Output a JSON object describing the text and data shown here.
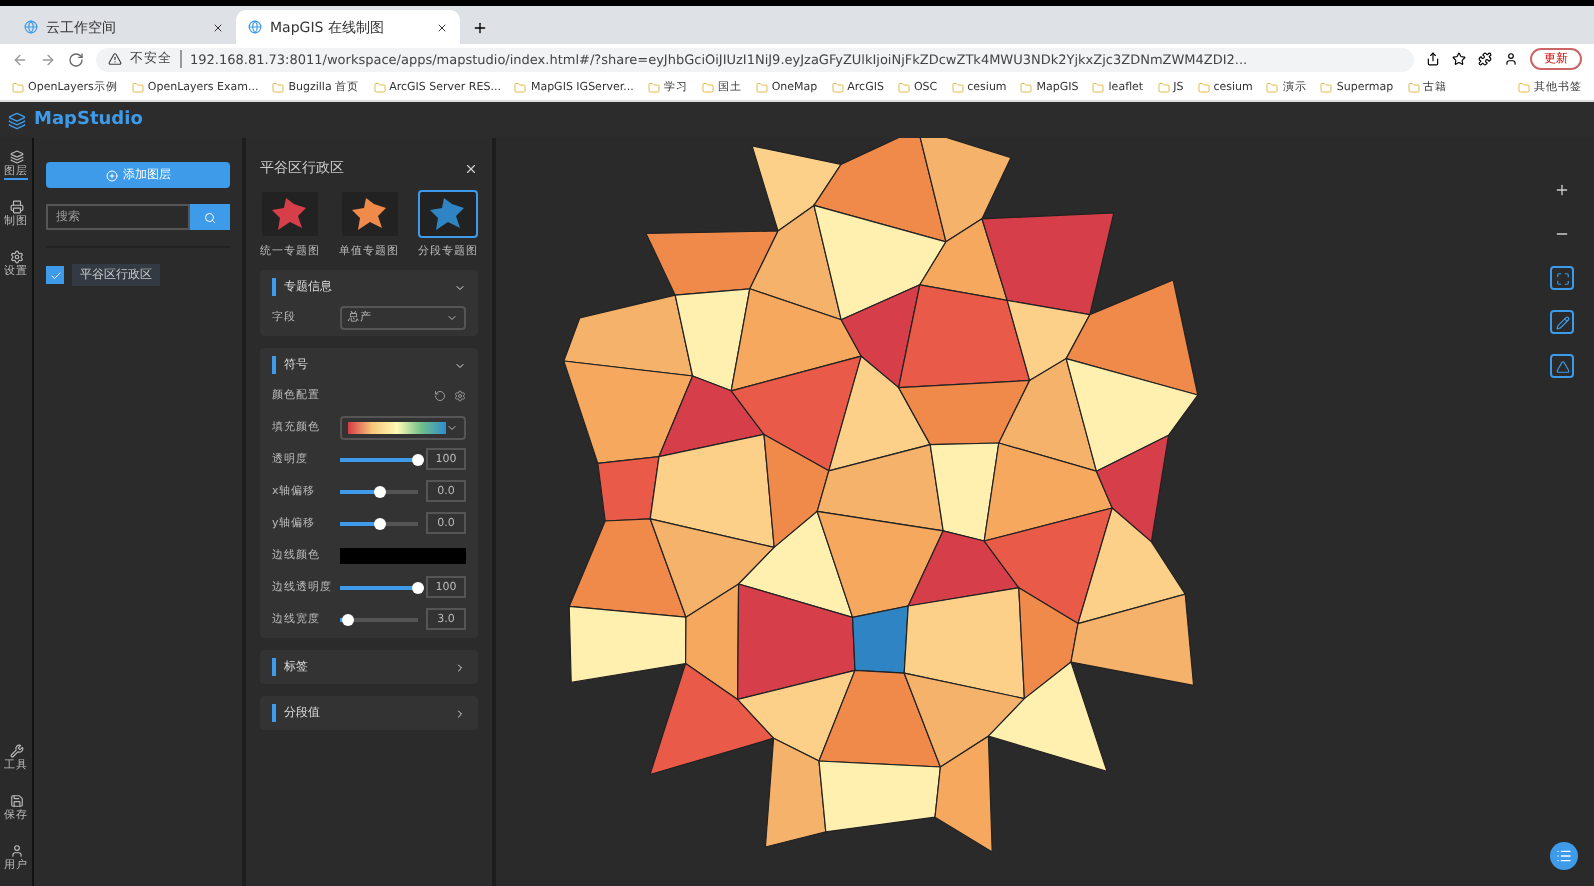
{
  "browser": {
    "tabs": [
      {
        "title": "云工作空间",
        "selected": false
      },
      {
        "title": "MapGIS 在线制图",
        "selected": true
      }
    ],
    "address": {
      "security": "不安全",
      "url": "192.168.81.73:8011/workspace/apps/mapstudio/index.html#/?share=eyJhbGciOiJIUzI1NiJ9.eyJzaGFyZUlkIjoiNjFkZDcwZTk4MWU3NDk2YjkxZjc3ZDNmZWM4ZDI2..."
    },
    "update_button": "更新",
    "bookmarks": [
      "OpenLayers示例",
      "OpenLayers Exam...",
      "Bugzilla 首页",
      "ArcGIS Server RES...",
      "MapGIS IGServer...",
      "学习",
      "国土",
      "OneMap",
      "ArcGIS",
      "OSC",
      "cesium",
      "MapGIS",
      "leaflet",
      "JS",
      "cesium",
      "演示",
      "Supermap",
      "古籍"
    ],
    "other_bookmarks": "其他书签"
  },
  "app": {
    "title": "MapStudio",
    "rail_top": [
      {
        "label": "图层",
        "selected": true
      },
      {
        "label": "制图",
        "selected": false
      },
      {
        "label": "设置",
        "selected": false
      }
    ],
    "rail_bottom": [
      {
        "label": "工具",
        "selected": false
      },
      {
        "label": "保存",
        "selected": false
      },
      {
        "label": "用户",
        "selected": false
      }
    ],
    "layer_panel": {
      "add_button": "添加图层",
      "search": {
        "placeholder": "搜索"
      },
      "layers": [
        {
          "name": "平谷区行政区",
          "checked": true
        }
      ]
    },
    "properties": {
      "title": "平谷区行政区",
      "thumbnails": [
        {
          "label": "统一专题图",
          "selected": false
        },
        {
          "label": "单值专题图",
          "selected": false
        },
        {
          "label": "分段专题图",
          "selected": true
        }
      ],
      "sections": [
        {
          "title": "专题信息",
          "expanded": true,
          "rows": [
            {
              "kind": "select",
              "label": "字段",
              "value": "总产"
            }
          ]
        },
        {
          "title": "符号",
          "expanded": true,
          "rows": [
            {
              "kind": "preset",
              "label": "颜色配置"
            },
            {
              "kind": "gradient",
              "label": "填充颜色"
            },
            {
              "kind": "slider",
              "label": "透明度",
              "level": 1,
              "value": "100"
            },
            {
              "kind": "slider",
              "label": "x轴偏移",
              "level": 0.5,
              "value": "0.0"
            },
            {
              "kind": "slider",
              "label": "y轴偏移",
              "level": 0.5,
              "value": "0.0"
            },
            {
              "kind": "color",
              "label": "边线颜色",
              "color": "#000000"
            },
            {
              "kind": "slider",
              "label": "边线透明度",
              "level": 1,
              "value": "100"
            },
            {
              "kind": "slider",
              "label": "边线宽度",
              "level": 0.1,
              "value": "3.0"
            }
          ]
        },
        {
          "title": "标签",
          "expanded": false
        },
        {
          "title": "分段值",
          "expanded": false
        }
      ]
    }
  }
}
